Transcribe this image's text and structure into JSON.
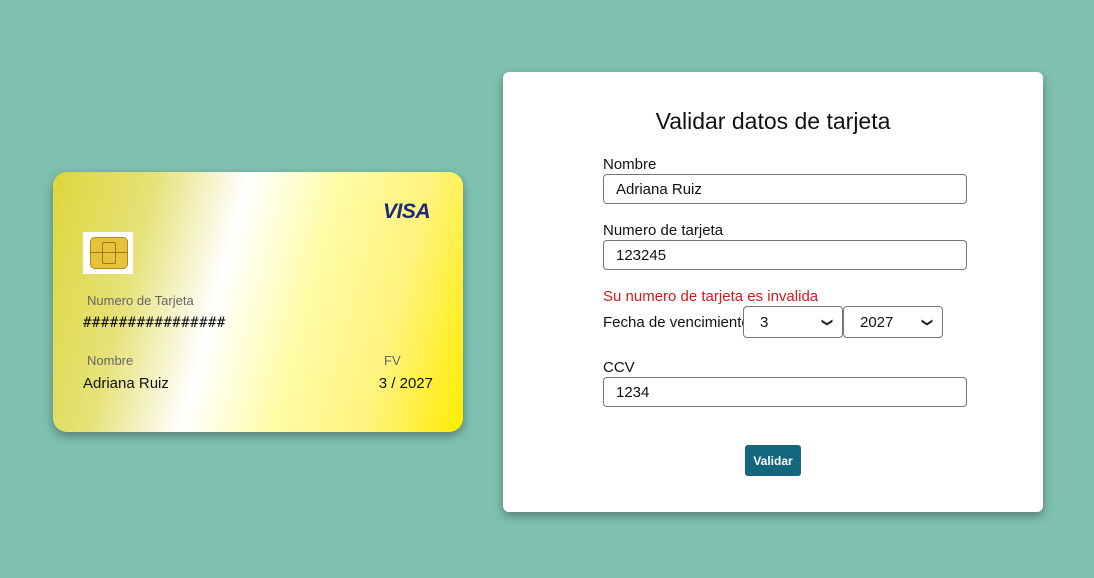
{
  "card": {
    "brand": "VISA",
    "number_label": "Numero de Tarjeta",
    "number_value": "################",
    "name_label": "Nombre",
    "name_value": "Adriana Ruiz",
    "expiry_label": "FV",
    "expiry_value": "3 / 2027"
  },
  "form": {
    "title": "Validar datos de tarjeta",
    "name_label": "Nombre",
    "name_value": "Adriana Ruiz",
    "number_label": "Numero de tarjeta",
    "number_value": "123245",
    "error_message": "Su numero de tarjeta es invalida",
    "expiry_label": "Fecha de vencimiento",
    "month_selected": "3",
    "year_selected": "2027",
    "ccv_label": "CCV",
    "ccv_value": "1234",
    "submit_label": "Validar"
  },
  "colors": {
    "background": "#7fc1b0",
    "button": "#12677f",
    "error": "#d11a1a",
    "visa_brand": "#1a2b7a"
  }
}
